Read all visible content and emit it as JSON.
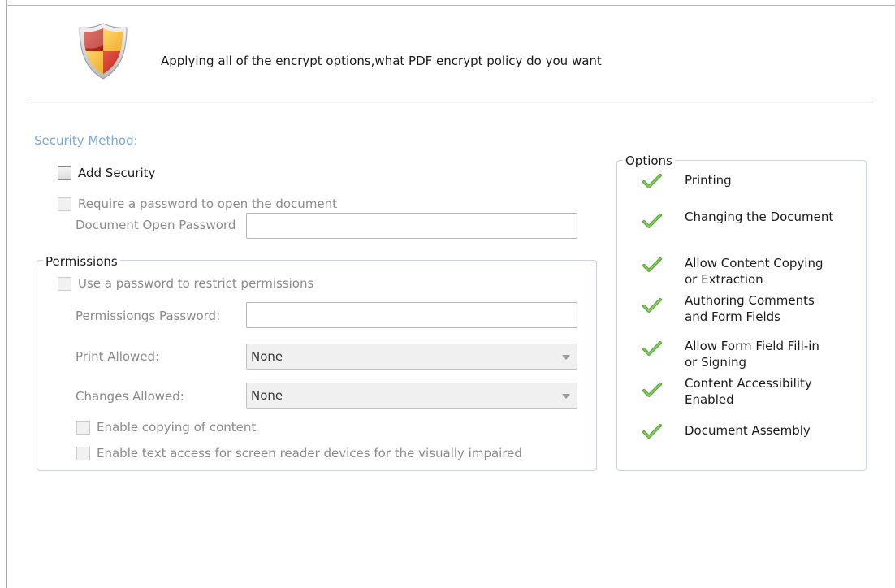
{
  "header": {
    "icon": "security-shield-icon",
    "text": "Applying all of the encrypt options,what PDF encrypt policy do you want"
  },
  "security_method": {
    "label": "Security Method:",
    "add_security": {
      "label": "Add Security",
      "checked": false
    },
    "require_open_password": {
      "label": "Require a password to open the document",
      "checked": false
    },
    "open_password": {
      "label": "Document Open Password",
      "value": ""
    }
  },
  "permissions": {
    "title": "Permissions",
    "use_password": {
      "label": "Use a password to restrict permissions",
      "checked": false
    },
    "permissions_password": {
      "label": "Permissiongs Password:",
      "value": ""
    },
    "print_allowed": {
      "label": "Print Allowed:",
      "value": "None"
    },
    "changes_allowed": {
      "label": "Changes Allowed:",
      "value": "None"
    },
    "enable_copying": {
      "label": "Enable copying of content",
      "checked": false
    },
    "enable_text_access": {
      "label": "Enable text access for screen reader devices for the visually impaired",
      "checked": false
    }
  },
  "options": {
    "title": "Options",
    "check_icon": "green-check-icon",
    "items": [
      {
        "line1": "Printing",
        "line2": ""
      },
      {
        "line1": "Changing the Document",
        "line2": ""
      },
      {
        "line1": "Allow Content Copying",
        "line2": "or Extraction"
      },
      {
        "line1": "Authoring Comments",
        "line2": "and Form Fields"
      },
      {
        "line1": "Allow Form Field Fill-in",
        "line2": "or Signing"
      },
      {
        "line1": "Content Accessibility",
        "line2": "Enabled"
      },
      {
        "line1": "Document Assembly",
        "line2": ""
      }
    ]
  },
  "colors": {
    "section_label": "#7ea6cf",
    "disabled_text": "#8a8a8a",
    "check_green": "#5aa83c"
  }
}
